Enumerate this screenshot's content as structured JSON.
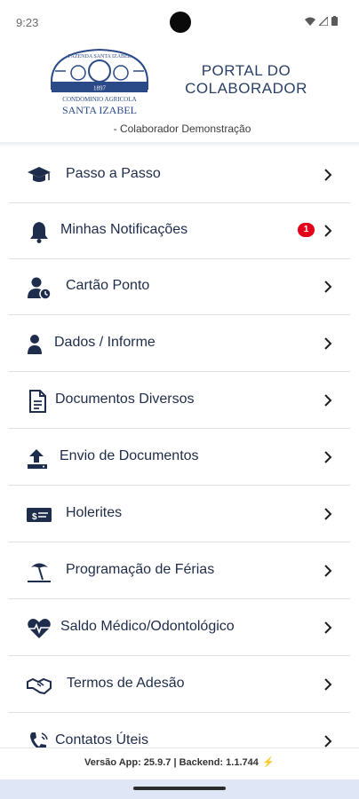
{
  "status": {
    "time": "9:23"
  },
  "header": {
    "portal_line1": "PORTAL DO",
    "portal_line2": "COLABORADOR",
    "colaborador": "- Colaborador Demonstração",
    "logo_text": [
      "FAZENDA SANTA IZABEL",
      "1897",
      "CONDOMINIO AGRICOLA",
      "SANTA IZABEL"
    ]
  },
  "menu": [
    {
      "label": "Passo a Passo",
      "icon": "graduation-cap-icon"
    },
    {
      "label": "Minhas Notificações",
      "icon": "bell-icon",
      "badge": "1"
    },
    {
      "label": "Cartão Ponto",
      "icon": "user-clock-icon"
    },
    {
      "label": "Dados / Informe",
      "icon": "user-icon"
    },
    {
      "label": "Documentos Diversos",
      "icon": "document-icon"
    },
    {
      "label": "Envio de Documentos",
      "icon": "upload-icon"
    },
    {
      "label": "Holerites",
      "icon": "money-check-icon"
    },
    {
      "label": "Programação de Férias",
      "icon": "umbrella-beach-icon"
    },
    {
      "label": "Saldo Médico/Odontológico",
      "icon": "heart-pulse-icon"
    },
    {
      "label": "Termos de Adesão",
      "icon": "handshake-icon"
    },
    {
      "label": "Contatos Úteis",
      "icon": "phone-icon"
    }
  ],
  "footer": {
    "version": "Versão App: 25.9.7 | Backend: 1.1.744",
    "bolt": "⚡"
  },
  "colors": {
    "primary": "#1f2d4d",
    "badge": "#e3001b",
    "nav_bar": "#dfe6f6"
  }
}
